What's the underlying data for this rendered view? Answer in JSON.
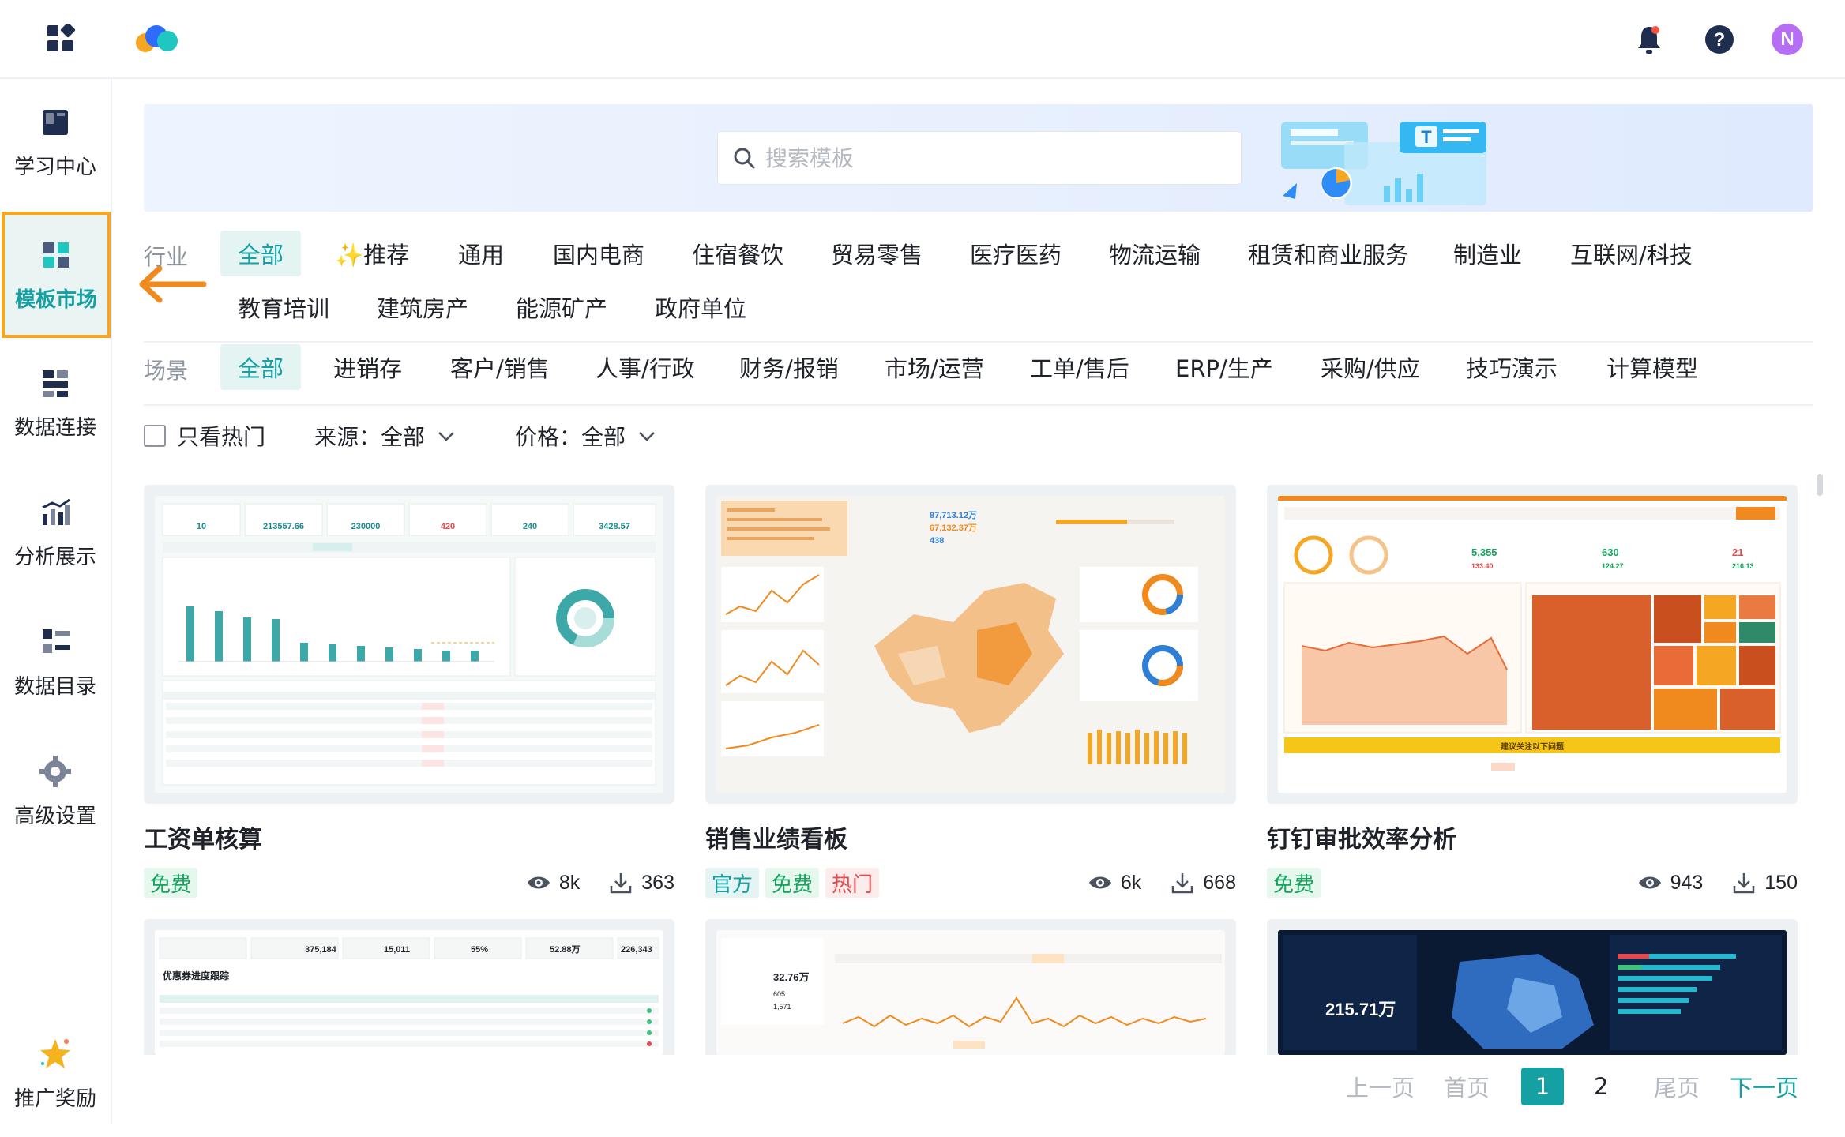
{
  "header": {
    "avatar_letter": "N",
    "accent": "#15a0a4"
  },
  "sidebar": {
    "items": [
      {
        "label": "学习中心",
        "icon": "book-icon"
      },
      {
        "label": "模板市场",
        "icon": "template-icon",
        "active": true
      },
      {
        "label": "数据连接",
        "icon": "data-connect-icon"
      },
      {
        "label": "分析展示",
        "icon": "chart-icon"
      },
      {
        "label": "数据目录",
        "icon": "catalog-icon"
      },
      {
        "label": "高级设置",
        "icon": "settings-icon"
      },
      {
        "label": "推广奖励",
        "icon": "star-icon"
      }
    ]
  },
  "search": {
    "placeholder": "搜索模板"
  },
  "filters": {
    "industry_label": "行业",
    "industry": [
      "全部",
      "✨推荐",
      "通用",
      "国内电商",
      "住宿餐饮",
      "贸易零售",
      "医疗医药",
      "物流运输",
      "租赁和商业服务",
      "制造业",
      "互联网/科技",
      "教育培训",
      "建筑房产",
      "能源矿产",
      "政府单位"
    ],
    "scene_label": "场景",
    "scene": [
      "全部",
      "进销存",
      "客户/销售",
      "人事/行政",
      "财务/报销",
      "市场/运营",
      "工单/售后",
      "ERP/生产",
      "采购/供应",
      "技巧演示",
      "计算模型"
    ],
    "hot_only": "只看热门",
    "source": "来源：全部",
    "price": "价格：全部"
  },
  "cards": [
    {
      "title": "工资单核算",
      "tags": [
        "免费"
      ],
      "views": "8k",
      "downloads": "363"
    },
    {
      "title": "销售业绩看板",
      "tags": [
        "官方",
        "免费",
        "热门"
      ],
      "views": "6k",
      "downloads": "668"
    },
    {
      "title": "钉钉审批效率分析",
      "tags": [
        "免费"
      ],
      "views": "943",
      "downloads": "150"
    }
  ],
  "thumbs": {
    "salary_kpis": [
      "10",
      "213557.66",
      "230000",
      "420",
      "240",
      "3428.57"
    ],
    "sales_kpis": [
      "87,713.12万",
      "67,132.37万",
      "438"
    ],
    "dingtalk_kpis": [
      "5,355",
      "630",
      "21",
      "133.40",
      "124.27",
      "216.13"
    ],
    "dingtalk_banner": "建议关注以下问题",
    "row2_a_kpis": [
      "375,184",
      "15,011",
      "55%",
      "52.88万",
      "226,343"
    ],
    "row2_a_title": "优惠券进度跟踪",
    "row2_b_kpis": [
      "32.76万",
      "605",
      "1,571"
    ],
    "row2_c_kpi": "215.71万"
  },
  "pagination": {
    "prev": "上一页",
    "first": "首页",
    "pages": [
      "1",
      "2"
    ],
    "current": "1",
    "last": "尾页",
    "next": "下一页"
  }
}
